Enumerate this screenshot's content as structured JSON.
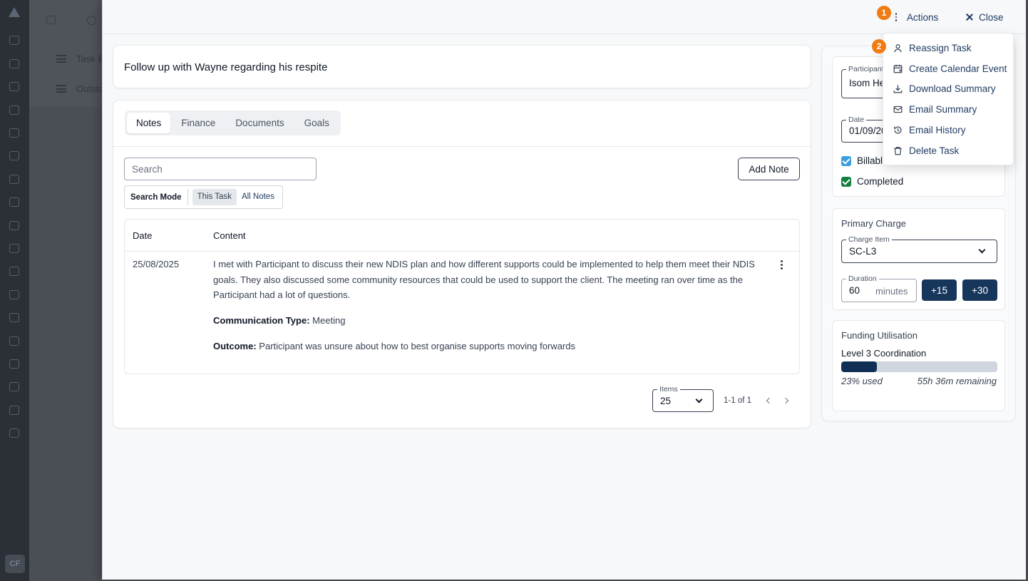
{
  "background": {
    "user_initials": "CF",
    "menu_items": [
      "Task B",
      "Outsta"
    ]
  },
  "header": {
    "actions_label": "Actions",
    "close_label": "Close",
    "step_badges": [
      "1",
      "2"
    ]
  },
  "task": {
    "title": "Follow up with Wayne regarding his respite"
  },
  "tabs": [
    {
      "label": "Notes",
      "active": true
    },
    {
      "label": "Finance",
      "active": false
    },
    {
      "label": "Documents",
      "active": false
    },
    {
      "label": "Goals",
      "active": false
    }
  ],
  "notes": {
    "search_placeholder": "Search",
    "add_note_label": "Add Note",
    "search_mode": {
      "label": "Search Mode",
      "options": [
        "This Task",
        "All Notes"
      ],
      "selected": "This Task"
    },
    "columns": [
      "Date",
      "Content"
    ],
    "rows": [
      {
        "date": "25/08/2025",
        "content": "I met with Participant to discuss their new NDIS plan and how different supports could be implemented to help them meet their NDIS goals. They also discussed some community resources that could be used to support the client. The meeting ran over time as the Participant had a lot of questions.",
        "communication_type_label": "Communication Type:",
        "communication_type": "Meeting",
        "outcome_label": "Outcome:",
        "outcome": "Participant was unsure about how to best organise supports moving forwards"
      }
    ],
    "pagination": {
      "items_label": "Items",
      "items_per_page": "25",
      "range": "1-1 of 1"
    }
  },
  "details": {
    "participant_label": "Participant",
    "participant_value": "Isom He",
    "date_label": "Date",
    "date_value": "01/09/20",
    "billable_label": "Billable",
    "billable_checked": true,
    "completed_label": "Completed",
    "completed_checked": true
  },
  "primary_charge": {
    "title": "Primary Charge",
    "charge_item_label": "Charge Item",
    "charge_item_value": "SC-L3",
    "duration_label": "Duration",
    "duration_value": "60",
    "duration_unit": "minutes",
    "quick_add": [
      "+15",
      "+30"
    ]
  },
  "funding": {
    "title": "Funding Utilisation",
    "item": "Level 3 Coordination",
    "used_percent": 23,
    "used_text": "23% used",
    "remaining_text": "55h 36m remaining"
  },
  "actions_menu": [
    {
      "label": "Reassign Task",
      "icon": "user-icon"
    },
    {
      "label": "Create Calendar Event",
      "icon": "calendar-plus-icon"
    },
    {
      "label": "Download Summary",
      "icon": "download-icon"
    },
    {
      "label": "Email Summary",
      "icon": "mail-icon"
    },
    {
      "label": "Email History",
      "icon": "history-icon"
    },
    {
      "label": "Delete Task",
      "icon": "trash-icon"
    }
  ],
  "colors": {
    "accent_navy": "#16365c",
    "badge_orange": "#f07b13",
    "billable_check": "#3b9ede",
    "completed_check": "#15803d"
  }
}
